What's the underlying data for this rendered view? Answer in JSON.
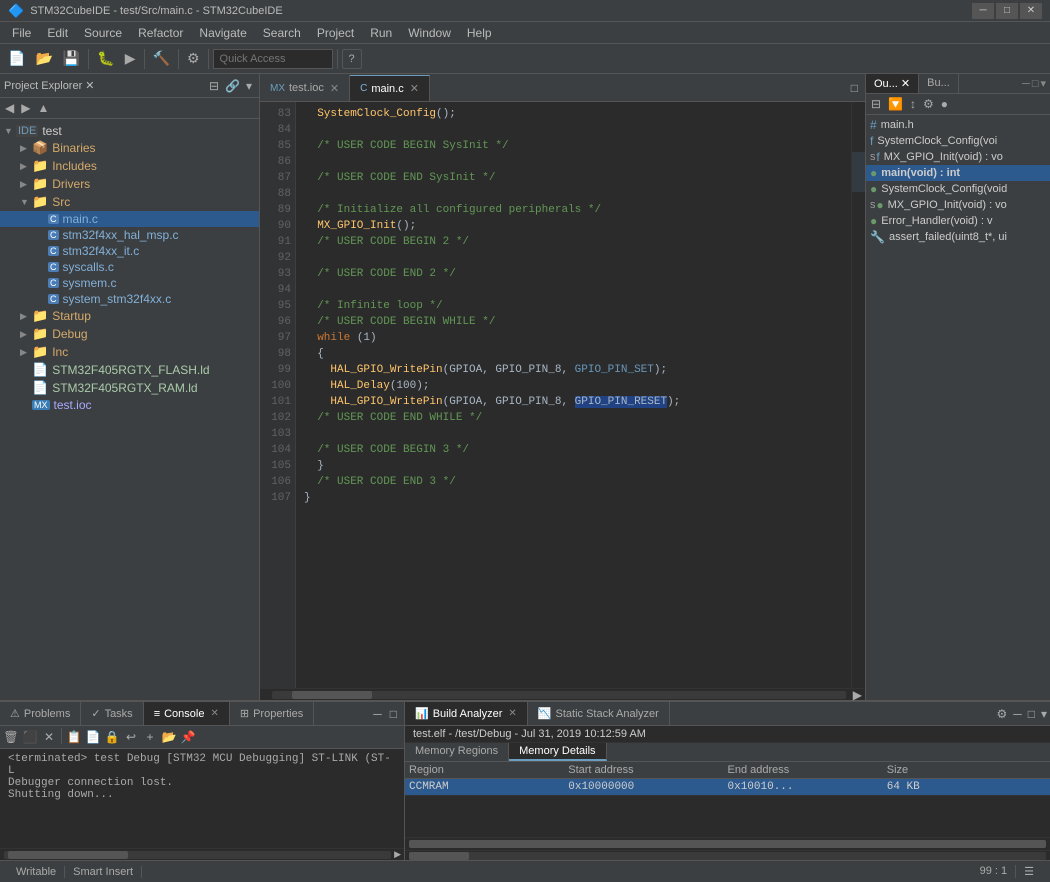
{
  "titlebar": {
    "title": "STM32CubeIDE - test/Src/main.c - STM32CubeIDE",
    "icon": "🔷"
  },
  "menubar": {
    "items": [
      "File",
      "Edit",
      "Source",
      "Refactor",
      "Navigate",
      "Search",
      "Project",
      "Run",
      "Window",
      "Help"
    ]
  },
  "toolbar": {
    "search_placeholder": "Quick Access",
    "search_value": "Quick Access"
  },
  "leftpanel": {
    "title": "Project Explorer",
    "tree": [
      {
        "label": "test",
        "type": "project",
        "indent": 0,
        "expanded": true,
        "icon": "IDE"
      },
      {
        "label": "Binaries",
        "type": "folder",
        "indent": 1,
        "icon": "📦"
      },
      {
        "label": "Includes",
        "type": "folder",
        "indent": 1,
        "icon": "📁"
      },
      {
        "label": "Drivers",
        "type": "folder",
        "indent": 1,
        "icon": "📁"
      },
      {
        "label": "Src",
        "type": "folder",
        "indent": 1,
        "expanded": true,
        "icon": "📁"
      },
      {
        "label": "main.c",
        "type": "cfile",
        "indent": 2,
        "icon": "C",
        "selected": true
      },
      {
        "label": "stm32f4xx_hal_msp.c",
        "type": "cfile",
        "indent": 2,
        "icon": "C"
      },
      {
        "label": "stm32f4xx_it.c",
        "type": "cfile",
        "indent": 2,
        "icon": "C"
      },
      {
        "label": "syscalls.c",
        "type": "cfile",
        "indent": 2,
        "icon": "C"
      },
      {
        "label": "sysmem.c",
        "type": "cfile",
        "indent": 2,
        "icon": "C"
      },
      {
        "label": "system_stm32f4xx.c",
        "type": "cfile",
        "indent": 2,
        "icon": "C"
      },
      {
        "label": "Startup",
        "type": "folder",
        "indent": 1,
        "icon": "📁"
      },
      {
        "label": "Debug",
        "type": "folder",
        "indent": 1,
        "icon": "📁"
      },
      {
        "label": "Inc",
        "type": "folder",
        "indent": 1,
        "icon": "📁"
      },
      {
        "label": "STM32F405RGTX_FLASH.ld",
        "type": "file",
        "indent": 1,
        "icon": "📄"
      },
      {
        "label": "STM32F405RGTX_RAM.ld",
        "type": "file",
        "indent": 1,
        "icon": "📄"
      },
      {
        "label": "test.ioc",
        "type": "iocfile",
        "indent": 1,
        "icon": "MX"
      }
    ]
  },
  "editor": {
    "tabs": [
      {
        "label": "test.ioc",
        "active": false,
        "icon": "MX"
      },
      {
        "label": "main.c",
        "active": true,
        "icon": "C"
      }
    ],
    "lines": [
      {
        "num": 83,
        "code": "  SystemClock_Config();",
        "type": "normal"
      },
      {
        "num": 84,
        "code": "",
        "type": "normal"
      },
      {
        "num": 85,
        "code": "  /* USER CODE BEGIN SysInit */",
        "type": "comment"
      },
      {
        "num": 86,
        "code": "",
        "type": "normal"
      },
      {
        "num": 87,
        "code": "  /* USER CODE END SysInit */",
        "type": "comment"
      },
      {
        "num": 88,
        "code": "",
        "type": "normal"
      },
      {
        "num": 89,
        "code": "  /* Initialize all configured peripherals */",
        "type": "comment"
      },
      {
        "num": 90,
        "code": "  MX_GPIO_Init();",
        "type": "normal"
      },
      {
        "num": 91,
        "code": "  /* USER CODE BEGIN 2 */",
        "type": "comment"
      },
      {
        "num": 92,
        "code": "",
        "type": "normal"
      },
      {
        "num": 93,
        "code": "  /* USER CODE END 2 */",
        "type": "comment"
      },
      {
        "num": 94,
        "code": "",
        "type": "normal"
      },
      {
        "num": 95,
        "code": "  /* Infinite loop */",
        "type": "comment"
      },
      {
        "num": 96,
        "code": "  /* USER CODE BEGIN WHILE */",
        "type": "comment"
      },
      {
        "num": 97,
        "code": "  while (1)",
        "type": "keyword"
      },
      {
        "num": 98,
        "code": "  {",
        "type": "normal"
      },
      {
        "num": 99,
        "code": "    HAL_GPIO_WritePin(GPIOA, GPIO_PIN_8, GPIO_PIN_SET);",
        "type": "macro"
      },
      {
        "num": 100,
        "code": "    HAL_Delay(100);",
        "type": "normal"
      },
      {
        "num": 101,
        "code": "    HAL_GPIO_WritePin(GPIOA, GPIO_PIN_8, GPIO_PIN_RESET);",
        "type": "macro_highlight"
      },
      {
        "num": 102,
        "code": "  /* USER CODE END WHILE */",
        "type": "comment"
      },
      {
        "num": 103,
        "code": "",
        "type": "normal"
      },
      {
        "num": 104,
        "code": "  /* USER CODE BEGIN 3 */",
        "type": "comment"
      },
      {
        "num": 105,
        "code": "  }",
        "type": "normal"
      },
      {
        "num": 106,
        "code": "  /* USER CODE END 3 */",
        "type": "comment"
      },
      {
        "num": 107,
        "code": "}",
        "type": "normal"
      }
    ]
  },
  "outline": {
    "tabs": [
      "Ou...",
      "Bu..."
    ],
    "items": [
      {
        "label": "main.h",
        "type": "include",
        "icon": "#",
        "color": "blue"
      },
      {
        "label": "SystemClock_Config(voi",
        "type": "func",
        "icon": "f",
        "color": "blue"
      },
      {
        "label": "MX_GPIO_Init(void) : vo",
        "type": "func",
        "icon": "f",
        "color": "blue",
        "superscript": "S"
      },
      {
        "label": "main(void) : int",
        "type": "func",
        "icon": "●",
        "color": "green",
        "selected": true
      },
      {
        "label": "SystemClock_Config(void",
        "type": "func",
        "icon": "●",
        "color": "green"
      },
      {
        "label": "MX_GPIO_Init(void) : vo",
        "type": "func",
        "icon": "●",
        "color": "green",
        "superscript": "S"
      },
      {
        "label": "Error_Handler(void) : v",
        "type": "func",
        "icon": "●",
        "color": "green"
      },
      {
        "label": "assert_failed(uint8_t*, ui",
        "type": "func",
        "icon": "🔧",
        "color": "gray"
      }
    ]
  },
  "bottom": {
    "tabs": [
      "Problems",
      "Tasks",
      "Console",
      "Properties"
    ],
    "active_tab": "Console",
    "console_text": "<terminated> test Debug [STM32 MCU Debugging] ST-LINK (ST-L\nDebugger connection lost.\nShutting down...",
    "build_analyzer": {
      "title": "Build Analyzer",
      "tab_active": true,
      "sub_tabs": [
        "Memory Regions",
        "Memory Details"
      ],
      "active_sub_tab": "Memory Details",
      "header": "test.elf - /test/Debug - Jul 31, 2019 10:12:59 AM",
      "table_headers": [
        "Region",
        "Start address",
        "End address",
        "Size"
      ],
      "rows": [
        {
          "region": "CCMRAM",
          "start": "0x10000000",
          "end": "0x10010...",
          "size": "64 KB",
          "selected": true
        }
      ]
    },
    "static_stack": {
      "title": "Static Stack Analyzer"
    }
  },
  "statusbar": {
    "items": [
      "Writable",
      "Smart Insert",
      "99 : 1"
    ]
  }
}
